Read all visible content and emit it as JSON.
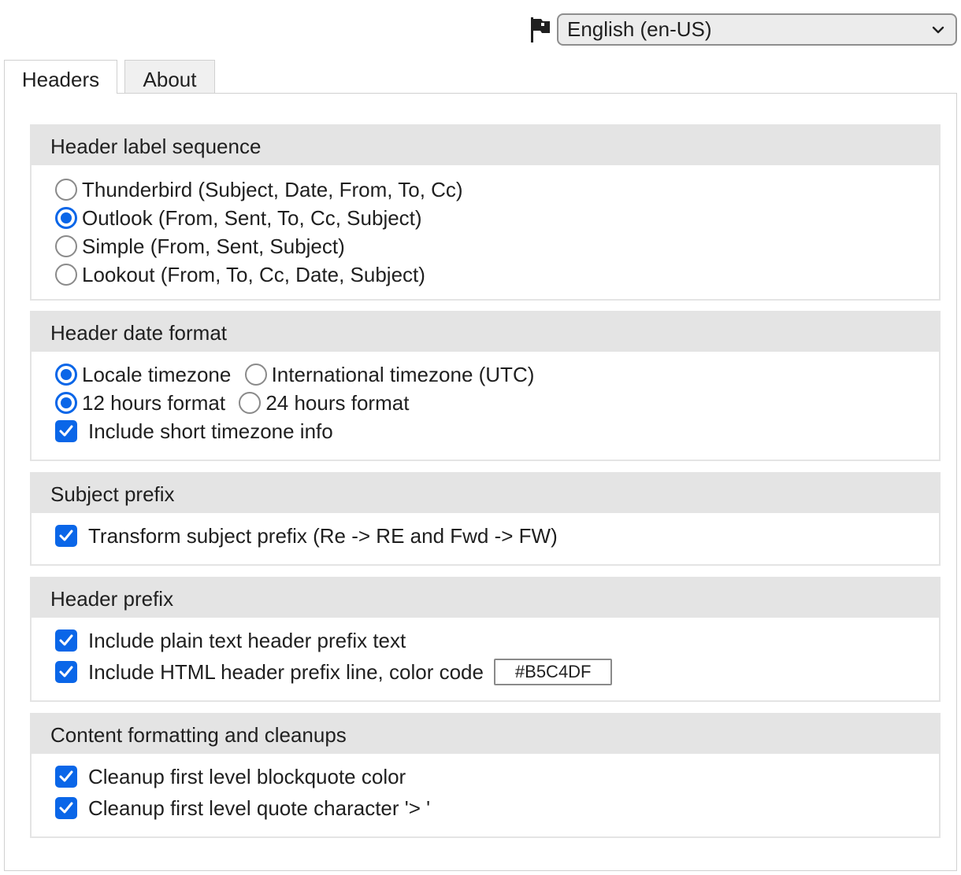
{
  "language": {
    "selected": "English (en-US)"
  },
  "tabs": [
    {
      "label": "Headers"
    },
    {
      "label": "About"
    }
  ],
  "sections": {
    "label_sequence": {
      "title": "Header label sequence",
      "options": [
        {
          "label": "Thunderbird (Subject, Date, From, To, Cc)",
          "checked": false
        },
        {
          "label": "Outlook (From, Sent, To, Cc, Subject)",
          "checked": true
        },
        {
          "label": "Simple (From, Sent, Subject)",
          "checked": false
        },
        {
          "label": "Lookout (From, To, Cc, Date, Subject)",
          "checked": false
        }
      ]
    },
    "date_format": {
      "title": "Header date format",
      "locale_tz": "Locale timezone",
      "intl_tz": "International timezone (UTC)",
      "h12": "12 hours format",
      "h24": "24 hours format",
      "short_tz": "Include short timezone info"
    },
    "subject_prefix": {
      "title": "Subject prefix",
      "transform": "Transform subject prefix (Re -> RE and Fwd -> FW)"
    },
    "header_prefix": {
      "title": "Header prefix",
      "plain": "Include plain text header prefix text",
      "html": "Include HTML header prefix line, color code",
      "color_value": "#B5C4DF"
    },
    "content": {
      "title": "Content formatting and cleanups",
      "blockquote": "Cleanup first level blockquote color",
      "quote_char": "Cleanup first level quote character '> '"
    }
  },
  "colors": {
    "accent": "#0a66e8",
    "section_header_bg": "#e4e4e4"
  }
}
